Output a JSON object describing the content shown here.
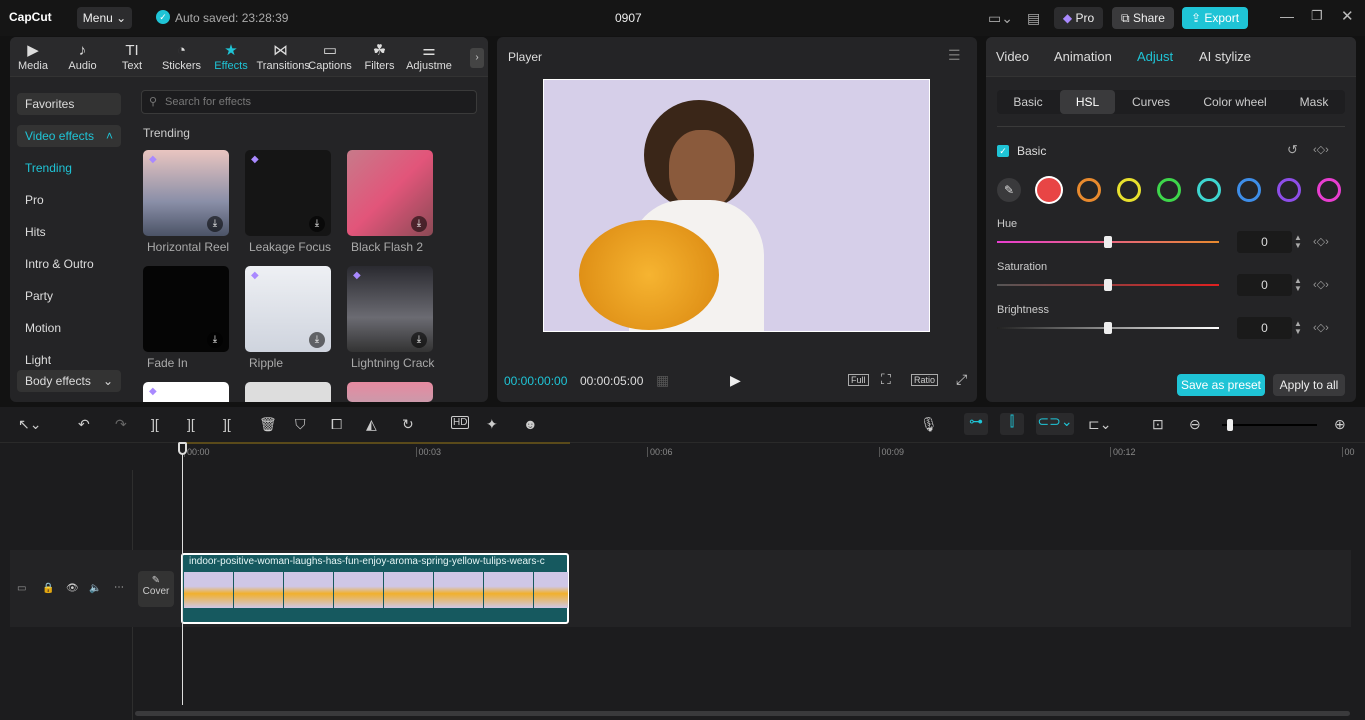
{
  "app": {
    "logo": "CapCut",
    "menu": "Menu",
    "autosave": "Auto saved: 23:28:39",
    "title": "0907",
    "pro": "Pro",
    "share": "Share",
    "export": "Export"
  },
  "tabs": [
    {
      "label": "Media",
      "icon": "media-icon",
      "glyph": "▶"
    },
    {
      "label": "Audio",
      "icon": "audio-icon",
      "glyph": "♪"
    },
    {
      "label": "Text",
      "icon": "text-icon",
      "glyph": "TI"
    },
    {
      "label": "Stickers",
      "icon": "sticker-icon",
      "glyph": "◔"
    },
    {
      "label": "Effects",
      "icon": "effects-star-icon",
      "glyph": "★"
    },
    {
      "label": "Transitions",
      "icon": "transition-icon",
      "glyph": "⋈"
    },
    {
      "label": "Captions",
      "icon": "captions-icon",
      "glyph": "▭"
    },
    {
      "label": "Filters",
      "icon": "filters-icon",
      "glyph": "☘"
    },
    {
      "label": "Adjustme",
      "icon": "adjust-icon",
      "glyph": "⚌"
    }
  ],
  "sidebar": {
    "favorites": "Favorites",
    "video_effects": "Video effects",
    "items": [
      "Trending",
      "Pro",
      "Hits",
      "Intro & Outro",
      "Party",
      "Motion",
      "Light"
    ],
    "body_effects": "Body effects"
  },
  "search": {
    "placeholder": "Search for effects"
  },
  "section": "Trending",
  "effects": [
    {
      "name": "Horizontal Reel",
      "pro": true
    },
    {
      "name": "Leakage Focus",
      "pro": true
    },
    {
      "name": "Black Flash 2",
      "pro": false
    },
    {
      "name": "Fade In",
      "pro": false
    },
    {
      "name": "Ripple",
      "pro": true
    },
    {
      "name": "Lightning Crack",
      "pro": true
    }
  ],
  "player": {
    "title": "Player",
    "current": "00:00:00:00",
    "duration": "00:00:05:00",
    "full": "Full",
    "ratio": "Ratio"
  },
  "right": {
    "tabs": [
      "Video",
      "Animation",
      "Adjust",
      "AI stylize"
    ],
    "subtabs": [
      "Basic",
      "HSL",
      "Curves",
      "Color wheel",
      "Mask"
    ],
    "basic": "Basic",
    "colors": [
      "#e84545",
      "#e88a2e",
      "#e8e02e",
      "#3ed64b",
      "#3ed6d0",
      "#3e8ee8",
      "#8e4ee8",
      "#e83ed0"
    ],
    "sliders": [
      {
        "label": "Hue",
        "value": "0",
        "level": 0.5
      },
      {
        "label": "Saturation",
        "value": "0",
        "level": 0.5
      },
      {
        "label": "Brightness",
        "value": "0",
        "level": 0.5
      }
    ],
    "save_preset": "Save as preset",
    "apply_all": "Apply to all"
  },
  "timeline": {
    "ticks": [
      "00:00",
      "00:03",
      "00:06",
      "00:09",
      "00:12",
      "00"
    ],
    "cover": "Cover",
    "clip_name": "indoor-positive-woman-laughs-has-fun-enjoy-aroma-spring-yellow-tulips-wears-c",
    "zoom_level": 0.05
  },
  "accent": "#1fc4d6"
}
